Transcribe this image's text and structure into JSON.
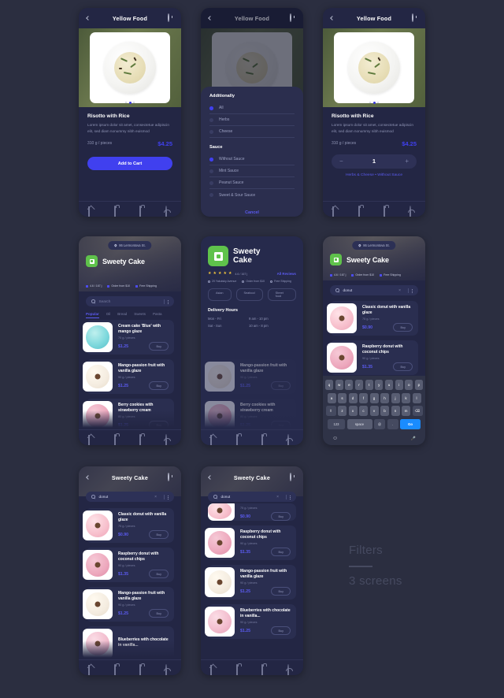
{
  "page": {
    "background": "#2b2e40",
    "accent": "#4040ef",
    "caption_title": "Filters",
    "caption_sub": "3 screens"
  },
  "detail": {
    "header_title": "Yellow Food",
    "back_icon": "chevron-left-icon",
    "clock_icon": "clock-icon",
    "product_name": "Risotto with Rice",
    "description": "Lorem ipsum dolor sit amet, consectetue adipiscin elit, sed diam nonummy nibh euismod",
    "weight": "310 g / pieces",
    "price": "$4.25",
    "cta_label": "Add to Cart",
    "quantity": "1",
    "minus_label": "−",
    "plus_label": "+",
    "selected_options": "Herbs & Cheese • Without Sauce"
  },
  "modal": {
    "section_additionally": "Additionally",
    "additionally_options": [
      {
        "label": "All",
        "selected": true
      },
      {
        "label": "Herbs",
        "selected": false
      },
      {
        "label": "Cheese",
        "selected": false
      }
    ],
    "section_sauce": "Sauce",
    "sauce_options": [
      {
        "label": "Without Sauce",
        "selected": true
      },
      {
        "label": "Mint Sauce",
        "selected": false
      },
      {
        "label": "Peanut Sauce",
        "selected": false
      },
      {
        "label": "Sweet & Sour Sauce",
        "selected": false
      }
    ],
    "cancel_label": "Cancel"
  },
  "shop": {
    "header_title": "Sweety Cake",
    "location": "86 Lermontova St.",
    "brand_name": "Sweety Cake",
    "brand_line1": "Sweety",
    "brand_line2": "Cake",
    "badges": [
      "4.6 / 167 j",
      "Order from $10",
      "Free Shipping"
    ],
    "search_placeholder": "Search",
    "search_value": "donut",
    "clear_label": "×",
    "categories": [
      {
        "label": "Popular",
        "active": true
      },
      {
        "label": "Oil",
        "active": false
      },
      {
        "label": "Bread",
        "active": false
      },
      {
        "label": "Sweets",
        "active": false
      },
      {
        "label": "Pasta",
        "active": false
      }
    ],
    "reviews": {
      "rating_stars": 5,
      "rating_text": "4.6 / 167 j",
      "all_reviews_label": "All Reviews",
      "info_badges": [
        "20 Yakutsky Avenue",
        "Order from $10",
        "Free Shipping"
      ],
      "tags": [
        "Asian",
        "Seafood",
        "Street food"
      ],
      "hours_title": "Delivery Hours",
      "hours": [
        {
          "days": "Mon - Fri",
          "time": "9 am - 10 pm"
        },
        {
          "days": "Sat - Sun",
          "time": "10 am - 8 pm"
        }
      ]
    }
  },
  "products": {
    "popular": [
      {
        "name": "Cream cake 'Blue' with mango glaze",
        "weight": "70 g / pieces",
        "price": "$1.25",
        "buy_label": "Buy",
        "thumb": "cake-blue"
      },
      {
        "name": "Mango-passion fruit with vanilla glaze",
        "weight": "90 g / pieces",
        "price": "$1.25",
        "buy_label": "Buy",
        "thumb": "donut-mango"
      },
      {
        "name": "Berry cookies with strawberry cream",
        "weight": "80 g / pieces",
        "price": "$1.25",
        "buy_label": "Buy",
        "thumb": "donut-rasp"
      }
    ],
    "donut_search": [
      {
        "name": "Classic donut with vanilla glaze",
        "weight": "75 g / pieces",
        "price": "$0.90",
        "buy_label": "Buy",
        "thumb": "donut-classic"
      },
      {
        "name": "Raspberry donut with coconut chips",
        "weight": "90 g / pieces",
        "price": "$1.35",
        "buy_label": "Buy",
        "thumb": "donut-rasp"
      },
      {
        "name": "Mango-passion fruit with vanilla glaze",
        "weight": "90 g / pieces",
        "price": "$1.25",
        "buy_label": "Buy",
        "thumb": "donut-mango"
      },
      {
        "name": "Blueberries with chocolate in vanilla...",
        "weight": "90 g / pieces",
        "price": "$1.25",
        "buy_label": "Buy",
        "thumb": "donut-blue"
      }
    ]
  },
  "keyboard": {
    "row1": [
      "q",
      "w",
      "e",
      "r",
      "t",
      "y",
      "u",
      "i",
      "o",
      "p"
    ],
    "row2": [
      "a",
      "s",
      "d",
      "f",
      "g",
      "h",
      "j",
      "k",
      "l"
    ],
    "row3": [
      "z",
      "x",
      "c",
      "v",
      "b",
      "n",
      "m"
    ],
    "shift_label": "⇧",
    "backspace_label": "⌫",
    "numbers_label": "123",
    "space_label": "space",
    "at_label": "@",
    "dot_label": ".",
    "go_label": "Go",
    "emoji_label": "☺",
    "mic_label": "🎤"
  }
}
